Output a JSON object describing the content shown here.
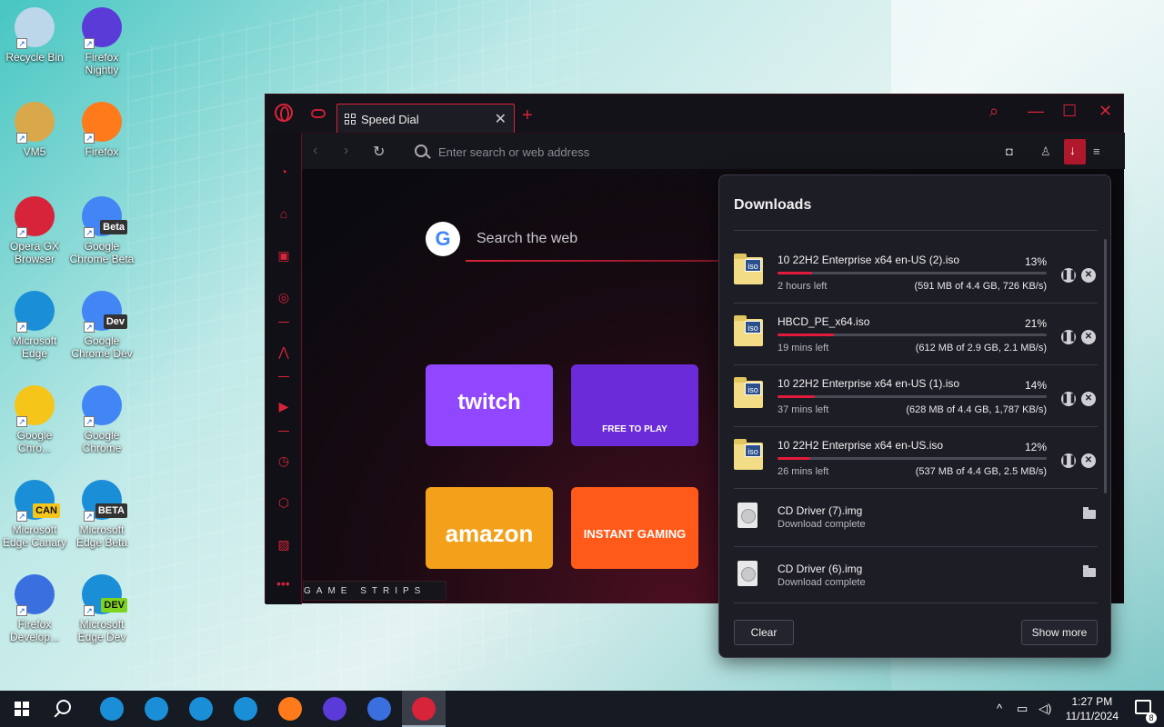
{
  "desktop": {
    "icons": [
      {
        "label": "Recycle Bin",
        "color": "#bcd7ea"
      },
      {
        "label": "Firefox Nightly",
        "color": "#5b3bd8"
      },
      {
        "label": "VM5",
        "color": "#d9a84a"
      },
      {
        "label": "Firefox",
        "color": "#ff7a1a"
      },
      {
        "label": "Opera GX Browser",
        "color": "#d8243a"
      },
      {
        "label": "Google Chrome Beta",
        "color": "#4285f4",
        "badge": "Beta"
      },
      {
        "label": "Microsoft Edge",
        "color": "#1a8fd8"
      },
      {
        "label": "Google Chrome Dev",
        "color": "#4285f4",
        "badge": "Dev"
      },
      {
        "label": "Google Chro...",
        "color": "#f5c51a"
      },
      {
        "label": "Google Chrome",
        "color": "#4285f4"
      },
      {
        "label": "Microsoft Edge Canary",
        "color": "#1a8fd8",
        "badge": "CAN"
      },
      {
        "label": "Microsoft Edge Beta",
        "color": "#1a8fd8",
        "badge": "BETA"
      },
      {
        "label": "Firefox Develop...",
        "color": "#3a6fe0"
      },
      {
        "label": "Microsoft Edge Dev",
        "color": "#1a8fd8",
        "badge": "DEV"
      }
    ]
  },
  "browser": {
    "tab_title": "Speed Dial",
    "tab_close": "✕",
    "new_tab": "+",
    "address_placeholder": "Enter search or web address",
    "search_placeholder": "Search the web",
    "google_letter": "G",
    "game_strips_label": "GAME STRIPS",
    "tiles": [
      {
        "label": "twitch",
        "color": "#9146ff"
      },
      {
        "label": "FREE TO PLAY",
        "color": "#6b2bd8"
      },
      {
        "label": "amazon",
        "color": "#f3a01a"
      },
      {
        "label": "INSTANT GAMING",
        "color": "#ff5a1a"
      }
    ],
    "accent": "#d8243a"
  },
  "downloads": {
    "title": "Downloads",
    "items": [
      {
        "name": "10 22H2 Enterprise x64 en-US (2).iso",
        "percent": "13%",
        "progress": 13,
        "time_left": "2 hours left",
        "info": "(591 MB of 4.4 GB, 726 KB/s)",
        "icon": "iso"
      },
      {
        "name": "HBCD_PE_x64.iso",
        "percent": "21%",
        "progress": 21,
        "time_left": "19 mins left",
        "info": "(612 MB of 2.9 GB, 2.1 MB/s)",
        "icon": "iso"
      },
      {
        "name": "10 22H2 Enterprise x64 en-US (1).iso",
        "percent": "14%",
        "progress": 14,
        "time_left": "37 mins left",
        "info": "(628 MB of 4.4 GB, 1,787 KB/s)",
        "icon": "iso"
      },
      {
        "name": "10 22H2 Enterprise x64 en-US.iso",
        "percent": "12%",
        "progress": 12,
        "time_left": "26 mins left",
        "info": "(537 MB of 4.4 GB, 2.5 MB/s)",
        "icon": "iso"
      }
    ],
    "completed": [
      {
        "name": "CD Driver (7).img",
        "status": "Download complete"
      },
      {
        "name": "CD Driver (6).img",
        "status": "Download complete"
      }
    ],
    "iso_label": "iso",
    "clear_label": "Clear",
    "show_more_label": "Show more"
  },
  "taskbar": {
    "time": "1:27 PM",
    "date": "11/11/2024",
    "notification_count": "8",
    "apps": [
      {
        "name": "edge",
        "color": "#1a8fd8"
      },
      {
        "name": "edge-beta",
        "color": "#1a8fd8"
      },
      {
        "name": "edge-canary",
        "color": "#1a8fd8"
      },
      {
        "name": "edge-dev",
        "color": "#1a8fd8"
      },
      {
        "name": "firefox",
        "color": "#ff7a1a"
      },
      {
        "name": "firefox-nightly",
        "color": "#5b3bd8"
      },
      {
        "name": "firefox-developer",
        "color": "#3a6fe0"
      },
      {
        "name": "opera-gx",
        "color": "#d8243a"
      }
    ]
  }
}
